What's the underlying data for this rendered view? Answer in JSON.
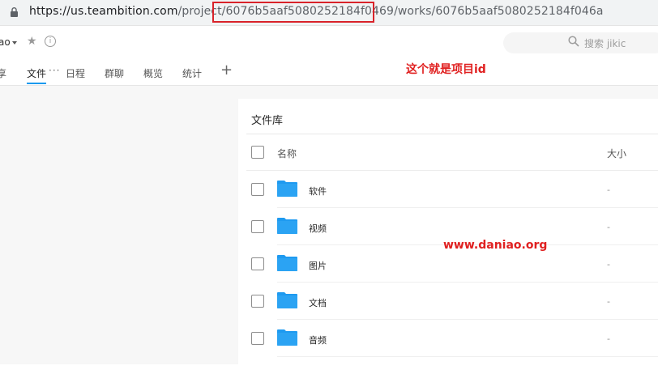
{
  "browser": {
    "url_host": "https://us.teambition.com",
    "url_path_prefix": "/project/",
    "url_project_id": "6076b5aaf5080252184f0469",
    "url_path_suffix": "/works/6076b5aaf5080252184f046a"
  },
  "project": {
    "name_fragment": "ao",
    "search_placeholder": "搜索 jikic"
  },
  "tabs": [
    {
      "label": "享"
    },
    {
      "label": "文件"
    },
    {
      "label": "日程"
    },
    {
      "label": "群聊"
    },
    {
      "label": "概览"
    },
    {
      "label": "统计"
    }
  ],
  "tab_more": "···",
  "tab_add": "+",
  "annotations": {
    "project_id_note": "这个就是项目id",
    "watermark": "www.daniao.org"
  },
  "library": {
    "title": "文件库",
    "col_name": "名称",
    "col_size": "大小",
    "items": [
      {
        "name": "软件",
        "size": "-"
      },
      {
        "name": "视频",
        "size": "-"
      },
      {
        "name": "图片",
        "size": "-"
      },
      {
        "name": "文档",
        "size": "-"
      },
      {
        "name": "音频",
        "size": "-"
      }
    ]
  },
  "colors": {
    "accent": "#1b9aee",
    "annotation": "#e02020",
    "folder": "#1e9af0"
  }
}
